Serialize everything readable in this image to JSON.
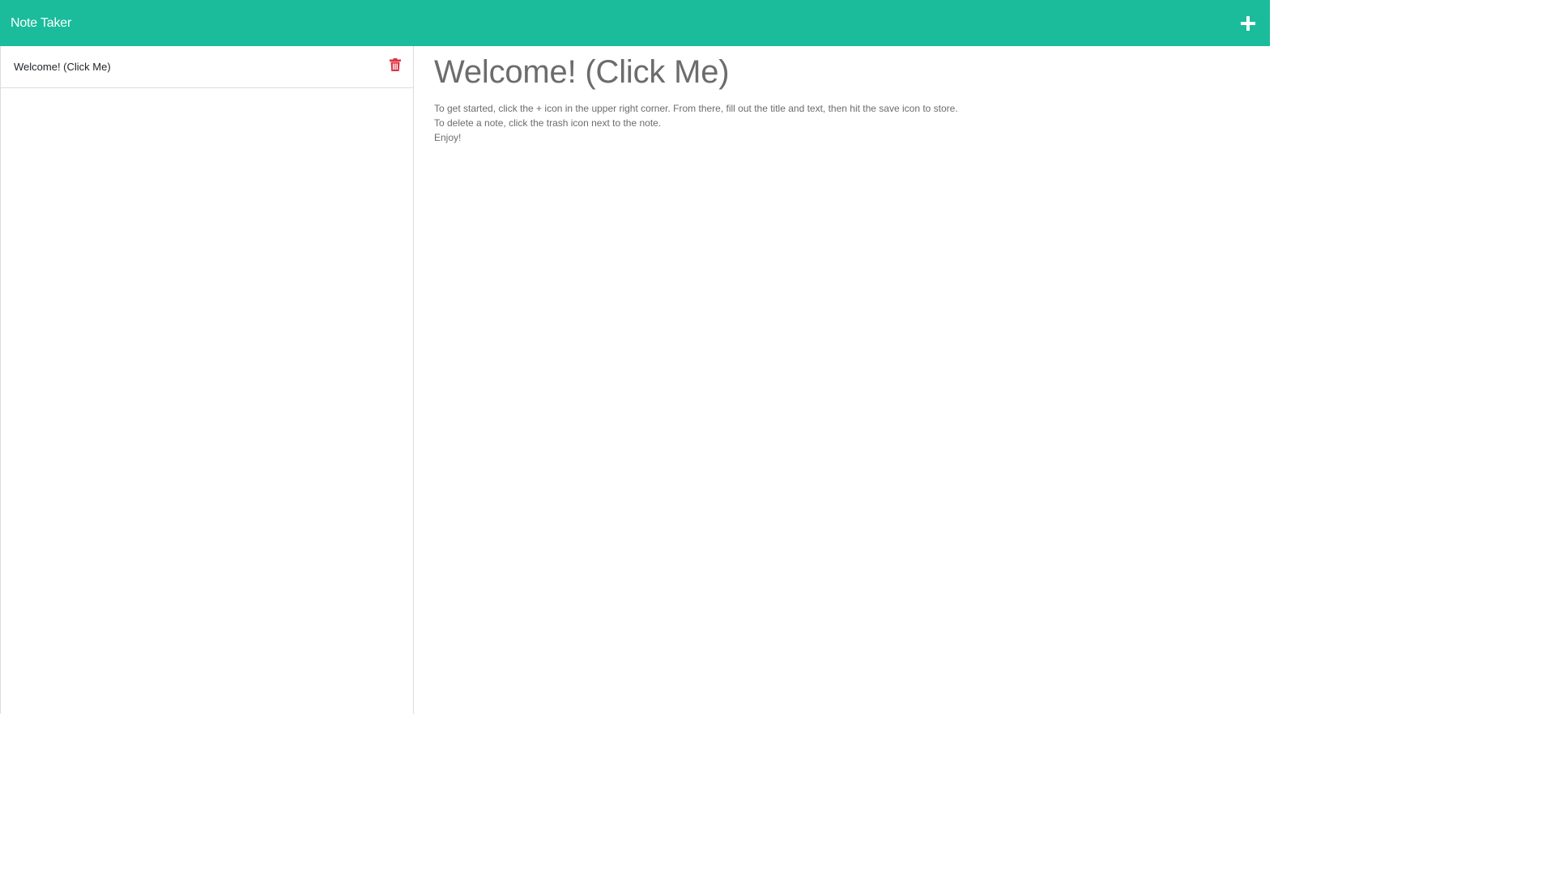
{
  "navbar": {
    "brand": "Note Taker",
    "new_note_icon": "plus-icon",
    "color": "#1abc9c"
  },
  "sidebar": {
    "notes": [
      {
        "title": "Welcome! (Click Me)",
        "delete_icon": "trash-icon",
        "delete_icon_color": "#dc3545"
      }
    ]
  },
  "main": {
    "note_title": "Welcome! (Click Me)",
    "note_text": "To get started, click the + icon in the upper right corner. From there, fill out the title and text, then hit the save icon to store.\nTo delete a note, click the trash icon next to the note.\nEnjoy!"
  }
}
